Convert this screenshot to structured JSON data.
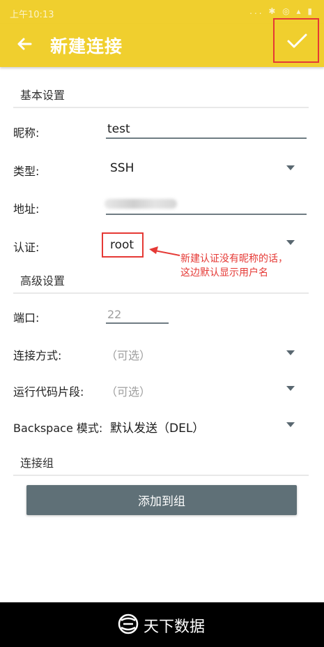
{
  "statusbar": {
    "time": "上午10:13",
    "icons": "... ✱ ◎ ▴ ▮"
  },
  "appbar": {
    "title": "新建连接"
  },
  "sections": {
    "basic": "基本设置",
    "advanced": "高级设置",
    "group": "连接组"
  },
  "fields": {
    "nickname": {
      "label": "昵称:",
      "value": "test"
    },
    "type": {
      "label": "类型:",
      "value": "SSH"
    },
    "address": {
      "label": "地址:",
      "value": ""
    },
    "auth": {
      "label": "认证:",
      "value": "root"
    },
    "port": {
      "label": "端口:",
      "placeholder": "22"
    },
    "connect_method": {
      "label": "连接方式:",
      "value": "（可选）"
    },
    "run_snippet": {
      "label": "运行代码片段:",
      "value": "（可选）"
    },
    "backspace": {
      "label": "Backspace 模式:",
      "value": "默认发送（DEL）"
    }
  },
  "annotation": {
    "line1": "新建认证没有昵称的话，",
    "line2": "这边默认显示用户名"
  },
  "buttons": {
    "add_to_group": "添加到组"
  },
  "footer": {
    "brand": "天下数据"
  },
  "colors": {
    "appbar": "#f0cf2e",
    "highlight": "#e53935",
    "button": "#5f7077"
  }
}
